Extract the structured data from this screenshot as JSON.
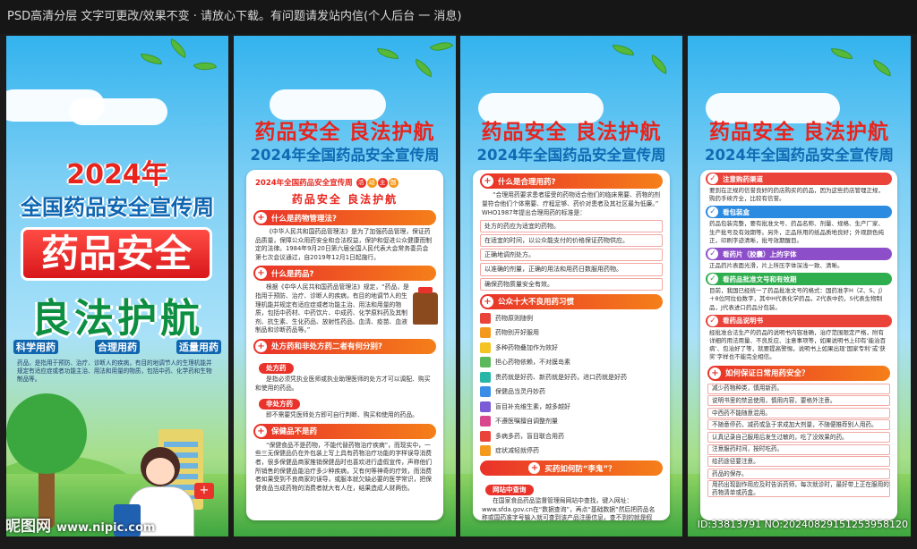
{
  "topbar": {
    "text": "PSD高清分层 文字可更改/效果不变 · 请放心下载。有问题请发站内信(个人后台 一 消息)"
  },
  "panel1": {
    "year": "2024年",
    "subtitle": "全国药品安全宣传周",
    "big1": "药品安全",
    "big2": "良法护航",
    "slogans": [
      "科学用药",
      "合理用药",
      "适量用药"
    ],
    "body": "药品，是指用于预防、治疗、诊断人的疾病，有目的地调节人的生理机能并规定有适应症或者功能主治、用法和用量的物质，包括中药、化学药和生物制品等。"
  },
  "shared": {
    "title1": "药品安全 良法护航",
    "title2": "2024年全国药品安全宣传周"
  },
  "panel2": {
    "card_title": "2024年全国药品安全宣传周",
    "badge": [
      "活",
      "动",
      "主",
      "题"
    ],
    "theme": "药品安全 良法护航",
    "s1": "什么是药物管理法?",
    "p1": "《中华人民共和国药品管理法》是为了加强药品管理，保证药品质量，保障公众用药安全和合法权益，保护和促进公众健康而制定的法律。1984年9月20日第六届全国人民代表大会常务委员会第七次会议通过，自2019年12月1日起施行。",
    "s2": "什么是药品?",
    "p2": "根据《中华人民共和国药品管理法》规定，“药品，是指用于预防、治疗、诊断人的疾病，有目的地调节人的生理机能并规定有适应症或者功能主治、用法和用量的物质，包括中药材、中药饮片、中成药、化学原料药及其制剂、抗生素、生化药品、放射性药品、血清、疫苗、血液制品和诊断药品等。”",
    "s3": "处方药和非处方药二者有何分别?",
    "sub1": "处方药",
    "p3": "是指必须凭执业医师或执业助理医师的处方才可以调配、购买和使用的药品。",
    "sub2": "非处方药",
    "p4": "即不需要凭医师处方即可自行判断、购买和使用的药品。",
    "s4": "保健品不是药",
    "p5": "“保健食品不是药物，不能代替药物治疗疾病”，而现实中，一些三无保健品仍在外包装上写上具有药物治疗功能的字样误导消费者，很多保健品商家推销保健品时也喜欢进行虚假宣传，声称他们所销售的保健品能治疗多少种疾病，又有何等神奇的疗效，而消费者如果受到不良商家的误导，或服本就欠缺必要的医学常识，把保健食品当成药物的消费者就大有人在，结果造成人财两伤。"
  },
  "panel3": {
    "s1": "什么是合理用药?",
    "p1": "“合理用药要求患者接受的药物适合他们的临床需要、药物的剂量符合他们个体需要、疗程足够、药价对患者及其社区最为低廉。”",
    "p2": "WHO1987年提出合理用药的标准是：",
    "criteria": [
      "处方的药应为适宜的药物。",
      "在适宜的时间，以公众能支付的价格保证药物供应。",
      "正确地调剂处方。",
      "以准确的剂量，正确的用法和用药日数服用药物。",
      "确保药物质量安全有效。"
    ],
    "s2": "公众十大不良用药习惯",
    "habits": [
      "药物原则随例",
      "药物别开好服用",
      "多种药物叠加作为效好",
      "担心药物依赖，不对膜岛素",
      "贵药就是好药、新药就是好药，进口药就是好药",
      "保健品当灵丹妙药",
      "盲目补充维生素，越多越好",
      "不遵医嘱擅自调整剂量",
      "多病多药，盲目联合用药",
      "症状减轻就停药"
    ],
    "habit_colors": [
      "#e9433a",
      "#f39a1e",
      "#f5c423",
      "#5cb85c",
      "#28b6a6",
      "#3a8ee6",
      "#7b5cd6",
      "#d9478d",
      "#e9433a",
      "#f39a1e"
    ],
    "s3": "买药如何防“李鬼”？",
    "sub1": "网站中查询",
    "p3": "在国家食品药品监督管理局网站中查找，键入网址：www.sfda.gov.cn在“数据查询”，再点“基础数据”然后把药品名称或国药准字号输入就可查到该产品注册信息，查不到的就是假药。"
  },
  "panel4": {
    "items": [
      {
        "label": "注意购药渠道",
        "color": "#e9433a",
        "text": "要到在正规的信誉良好的药店购买的药品，因为这些药店管理正规，购药手续齐全，比较有信誉。"
      },
      {
        "label": "看包装盒",
        "color": "#2b8be0",
        "text": "药品包装完整，要有批准文号、药品名称、剂量、规格、生产厂家、生产批号及有效期等。另外，正品所用的纸品质地良好；外观颜色纯正，印刷字迹清晰，批号效期醒目。"
      },
      {
        "label": "看药片（胶囊）上的字体",
        "color": "#8d4fc9",
        "text": "正品药片表面光滑，片上所压字体深浅一致、清晰。"
      },
      {
        "label": "看药品批准文号和有效期",
        "color": "#2fae4f",
        "text": "目前，我国已经统一了药品批准文号的格式：国药准字H（Z、S、J）＋8位阿拉伯数字，其中H代表化学药品，Z代表中药，S代表生物制品，J代表进口药品分包装。"
      },
      {
        "label": "看药品说明书",
        "color": "#e9433a",
        "text": "经批准合法生产的药品的说明书内容准确，治疗范围限定严格，附有详细的用法用量、不良反应、注意事项等，如果说明书上印有‘能治百病’、包治好了等，就要提高警惕，说明书上如果出现‘国家专利’或‘获奖’字样也不能完全相信。"
      }
    ],
    "s1": "如何保证日常用药安全？",
    "tips": [
      "减少药物种类，慎用新药。",
      "说明书里的禁忌使用，慎用内容，要格外注意。",
      "中西药不能随意混用。",
      "不随意停药，减药或急于求成加大剂量，不随便推荐别人用药。",
      "认真记录自己服用后发生过敏的，吃了没效果的药。",
      "注意服药时间，按时吃药。",
      "给药途径要注意。",
      "药品的保存。",
      "用药出现副作用应及时告诉药师，每次就诊时，最好带上正在服用的药物清单或药盒。"
    ]
  },
  "watermark": {
    "logo": "昵图网",
    "url": "www.nipic.com"
  },
  "id_text": "ID:33813791 NO:20240829151253958120"
}
